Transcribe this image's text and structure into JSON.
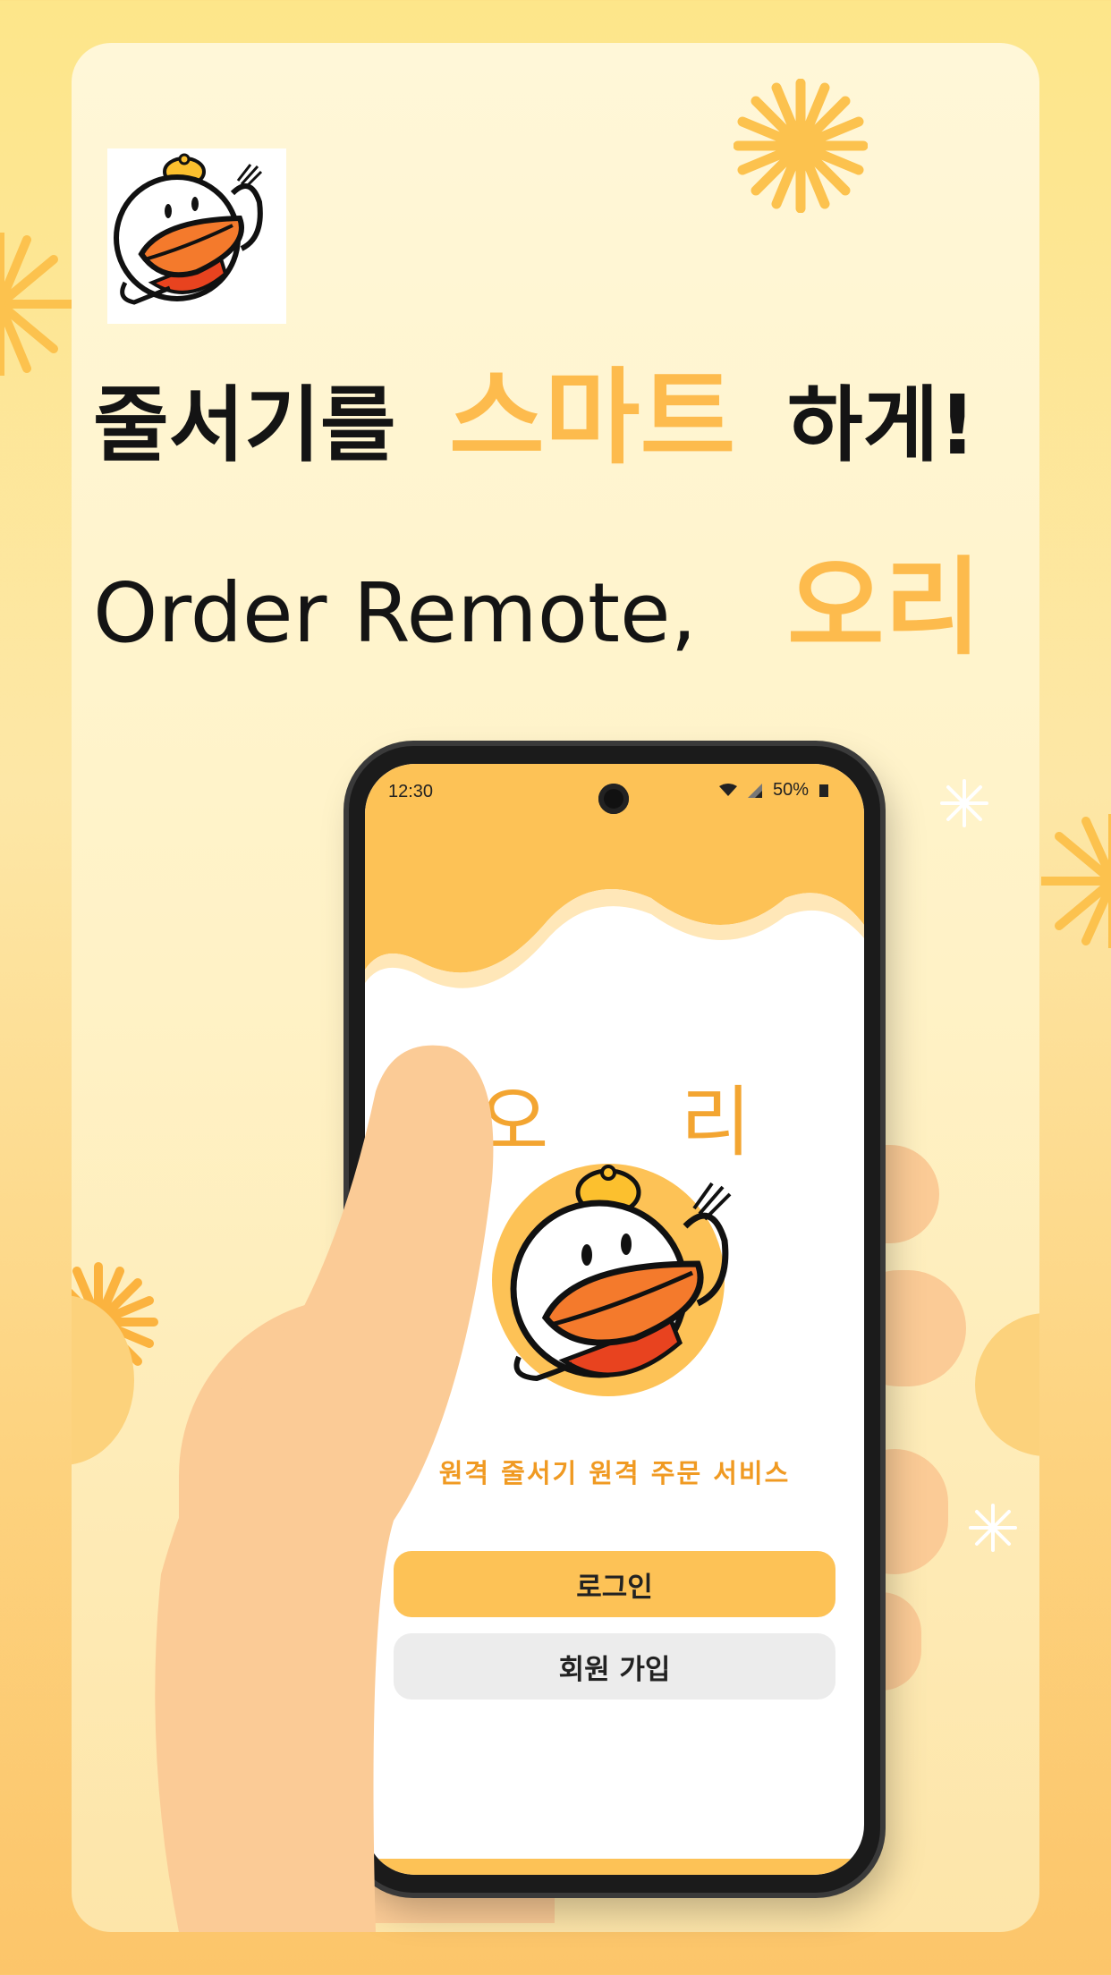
{
  "headline": {
    "line1_dark": "줄서기를",
    "line1_accent": "스마트",
    "line1_suffix": "하게!",
    "line2_dark": "Order Remote,",
    "line2_accent": "오리"
  },
  "phone": {
    "status_bar": {
      "time": "12:30",
      "battery": "50%"
    },
    "app_title": "오 리",
    "tagline": "원격 줄서기 원격 주문 서비스",
    "buttons": {
      "login": "로그인",
      "signup": "회원 가입"
    }
  },
  "colors": {
    "accent": "#fdbb4d",
    "title_orange": "#f3a531",
    "button_primary": "#fdc256",
    "button_secondary": "#ececec",
    "duck_bill": "#f47a2c",
    "scarf": "#e8431f"
  },
  "icons": [
    "duck-logo-icon",
    "wifi-icon",
    "signal-icon",
    "battery-icon",
    "camera-icon",
    "sunburst-icon",
    "sparkle-icon"
  ]
}
